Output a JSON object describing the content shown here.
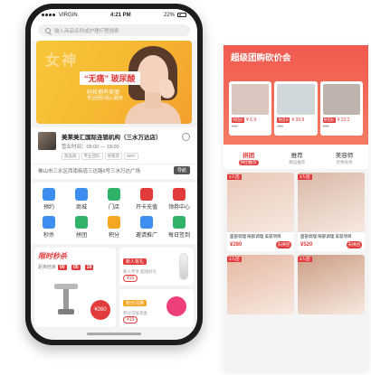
{
  "status_bar": {
    "carrier": "VIRGIN",
    "time": "4:21 PM",
    "battery": "22%"
  },
  "search": {
    "placeholder": "输入商品名称或护理疗程搜索"
  },
  "banner": {
    "deco_text": "女神",
    "tag_main": "“无痛” 玻尿酸",
    "tag_sub": "轻松拥有美丽",
    "tag_note": "专业团队贴心服务"
  },
  "shop": {
    "name": "美莱美汇国际连锁机构（三水万达店）",
    "hours": "营业时间：09:00 — 18:00",
    "tags": [
      "高品质",
      "专业团队",
      "地铁旁",
      "WIFI"
    ],
    "address": "佛山市三水区西南街道三达路6号三水万达广场",
    "nav_label": "导航"
  },
  "grid": [
    {
      "label": "预约",
      "color": "#3d8ef0",
      "icon": "calendar-icon"
    },
    {
      "label": "商城",
      "color": "#3d8ef0",
      "icon": "mall-icon"
    },
    {
      "label": "门店",
      "color": "#2fb36b",
      "icon": "store-icon"
    },
    {
      "label": "开卡充值",
      "color": "#e23b3b",
      "icon": "card-icon"
    },
    {
      "label": "领券中心",
      "color": "#e23b3b",
      "icon": "coupon-icon"
    },
    {
      "label": "秒杀",
      "color": "#3d8ef0",
      "icon": "clock-icon"
    },
    {
      "label": "拼团",
      "color": "#2fb36b",
      "icon": "puzzle-icon"
    },
    {
      "label": "积分",
      "color": "#f5a623",
      "icon": "points-icon"
    },
    {
      "label": "邀请推广",
      "color": "#3d8ef0",
      "icon": "invite-icon"
    },
    {
      "label": "每日签到",
      "color": "#2fb36b",
      "icon": "checkin-icon"
    }
  ],
  "seckill": {
    "title": "限时秒杀",
    "countdown_prefix": "距离结束",
    "h": "00",
    "m": "05",
    "s": "26",
    "price": "¥260"
  },
  "newcomer": {
    "badge": "新人有礼",
    "desc": "新人专享 超值好礼",
    "price": "¥19"
  },
  "points": {
    "badge": "积分兑换",
    "desc": "积分可抵现金",
    "price": "¥19"
  },
  "panel": {
    "title": "超级团购砍价会",
    "deals": [
      {
        "label": "拼团价",
        "price": "¥ 6.9",
        "orig": "¥19",
        "color": "#d9c7bf"
      },
      {
        "label": "拼团价",
        "price": "¥ 39.9",
        "orig": "¥59",
        "color": "#cfd7db"
      },
      {
        "label": "拼团价",
        "price": "¥ 22.2",
        "orig": "¥56",
        "color": "#bfb3ae"
      }
    ],
    "tabs": [
      {
        "label": "拼团",
        "sub": "拼团推荐",
        "active": true
      },
      {
        "label": "推荐",
        "sub": "精选推荐",
        "active": false
      },
      {
        "label": "美容师",
        "sub": "优秀技师",
        "active": false
      }
    ],
    "cards": [
      {
        "tag": "3人团",
        "title": "面部调理 眼部调理 美容项目",
        "price": "¥280",
        "btn": "去拼团",
        "color": "#e8c8b8"
      },
      {
        "tag": "3人团",
        "title": "面部调理 眼部调理 美容项目",
        "price": "¥520",
        "btn": "去拼团",
        "color": "#d8b8a8"
      },
      {
        "tag": "3人团",
        "title": "",
        "price": "",
        "btn": "",
        "color": "#e6b7a3"
      },
      {
        "tag": "3人团",
        "title": "",
        "price": "",
        "btn": "",
        "color": "#cc9d85"
      }
    ]
  }
}
